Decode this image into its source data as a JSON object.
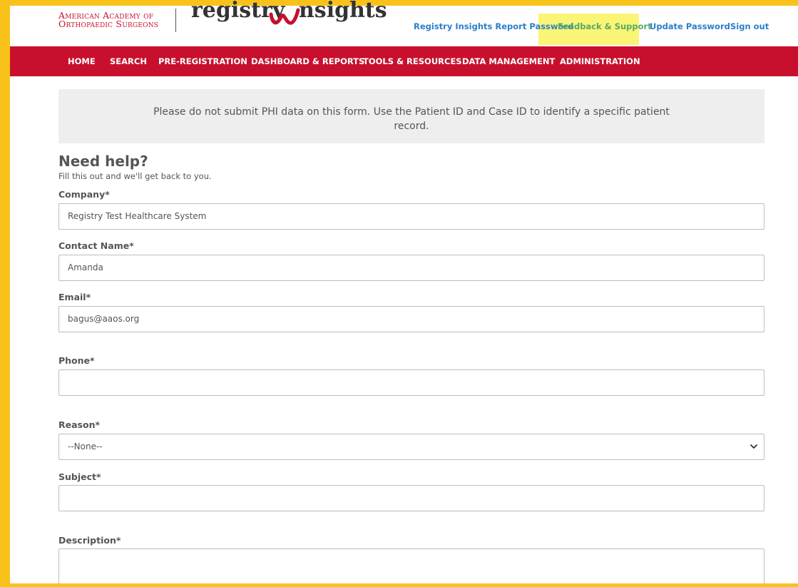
{
  "header": {
    "org_line1": "American Academy of",
    "org_line2": "Orthopaedic Surgeons",
    "product_word1": "registry",
    "product_word2": "nsights",
    "links": [
      {
        "label": "Registry Insights Report Password"
      },
      {
        "label": "Feedback & Support"
      },
      {
        "label": "Update Password"
      },
      {
        "label": "Sign out"
      }
    ]
  },
  "nav": {
    "items": [
      {
        "label": "HOME"
      },
      {
        "label": "SEARCH"
      },
      {
        "label": "PRE-REGISTRATION"
      },
      {
        "label": "DASHBOARD & REPORTS"
      },
      {
        "label": "TOOLS & RESOURCES"
      },
      {
        "label": "DATA MANAGEMENT"
      },
      {
        "label": "ADMINISTRATION"
      }
    ]
  },
  "notice": {
    "text": "Please do not submit PHI data on this form. Use the Patient ID and Case ID to identify a specific patient record."
  },
  "form": {
    "title": "Need help?",
    "subtitle": "Fill this out and we'll get back to you.",
    "company": {
      "label": "Company*",
      "value": "Registry Test Healthcare System"
    },
    "contact_name": {
      "label": "Contact Name*",
      "value": "Amanda"
    },
    "email": {
      "label": "Email*",
      "value": "bagus@aaos.org"
    },
    "phone": {
      "label": "Phone*",
      "value": ""
    },
    "reason": {
      "label": "Reason*",
      "value": "--None--"
    },
    "subject": {
      "label": "Subject*",
      "value": ""
    },
    "description": {
      "label": "Description*",
      "value": ""
    }
  },
  "colors": {
    "brand_red": "#c8102e",
    "link_blue": "#2a7fc7",
    "highlight_yellow": "#faf575",
    "frame_yellow": "#f8c21b"
  }
}
